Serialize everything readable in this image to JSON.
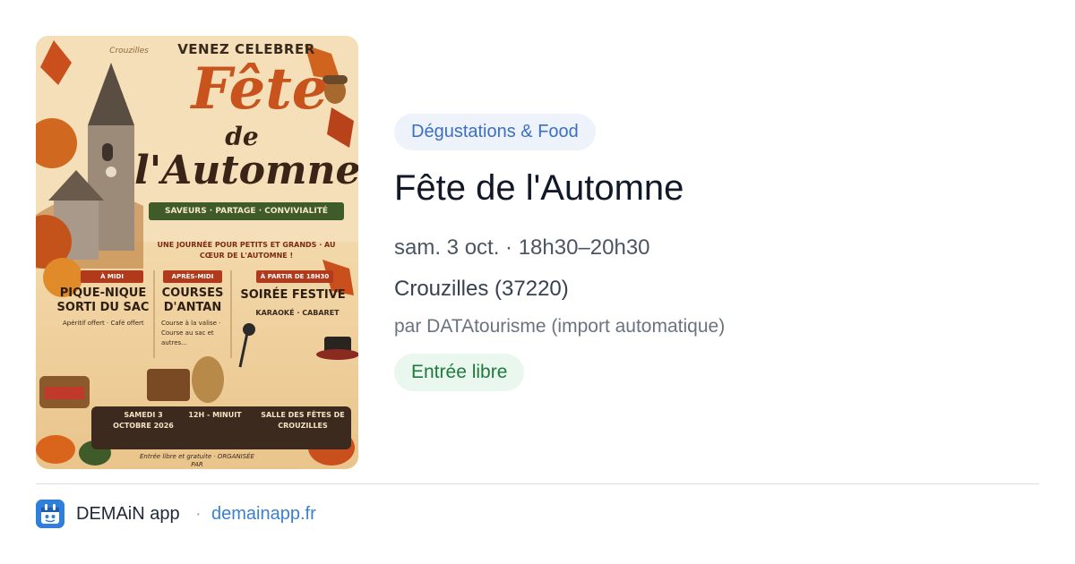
{
  "event": {
    "category_tag": "Dégustations & Food",
    "title": "Fête de l'Automne",
    "datetime": "sam. 3 oct. · 18h30–20h30",
    "location": "Crouzilles (37220)",
    "organizer": "par DATAtourisme (import automatique)",
    "price_badge": "Entrée libre"
  },
  "poster": {
    "venez": "VENEZ CELEBRER",
    "brand": "Crouzilles",
    "fete": "Fête",
    "de": "de",
    "automne": "l'Automne",
    "banner": "SAVEURS · PARTAGE · CONVIVIALITÉ",
    "journee": "UNE JOURNÉE POUR PETITS ET GRANDS · AU CŒUR DE L'AUTOMNE !",
    "columns": [
      {
        "header": "À MIDI",
        "title": "PIQUE-NIQUE SORTI DU SAC",
        "sub": "Apéritif offert · Café offert"
      },
      {
        "header": "APRÈS-MIDI",
        "title": "COURSES D'ANTAN",
        "sub": "Course à la valise · Course au sac et autres..."
      },
      {
        "header": "À PARTIR DE 18H30",
        "title": "SOIRÉE FESTIVE",
        "sub": "KARAOKÉ · CABARET"
      }
    ],
    "bar": {
      "date": "SAMEDI 3 OCTOBRE 2026",
      "hours": "12H - MINUIT",
      "venue": "SALLE DES FÊTES DE CROUZILLES"
    },
    "footer": "Entrée libre et gratuite · ORGANISÉE PAR"
  },
  "footer": {
    "app_name": "DEMAiN app",
    "separator": "·",
    "url": "demainapp.fr"
  },
  "colors": {
    "tag_bg": "#eef3fb",
    "tag_text": "#3b6fc4",
    "price_bg": "#eaf7ee",
    "price_text": "#1f7a3d",
    "link": "#3b7fd1",
    "logo_bg": "#2f7fd9"
  }
}
